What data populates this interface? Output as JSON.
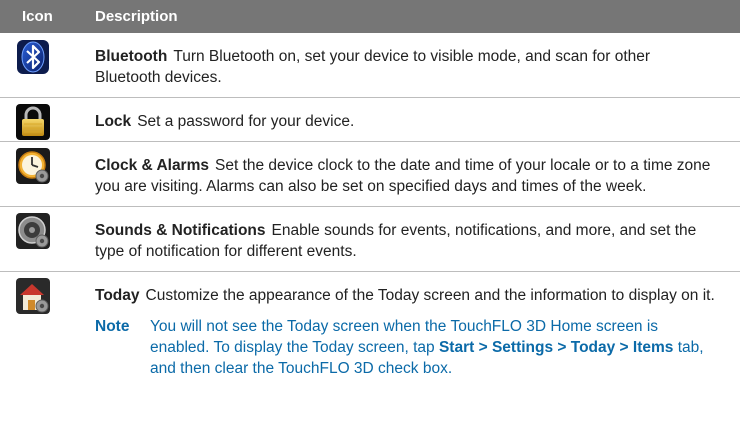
{
  "header": {
    "icon_col": "Icon",
    "description_col": "Description"
  },
  "rows": [
    {
      "icon": "bluetooth-icon",
      "title": "Bluetooth",
      "text": "Turn Bluetooth on, set your device to visible mode, and scan for other Bluetooth devices."
    },
    {
      "icon": "lock-icon",
      "title": "Lock",
      "text": "Set a password for your device."
    },
    {
      "icon": "clock-alarms-icon",
      "title": "Clock & Alarms",
      "text": "Set the device clock to the date and time of your locale or to a time zone you are visiting. Alarms can also be set on specified days and times of the week."
    },
    {
      "icon": "sounds-notifications-icon",
      "title": "Sounds & Notifications",
      "text": "Enable sounds for events, notifications, and more, and set the type of notification for different events."
    },
    {
      "icon": "today-home-icon",
      "title": "Today",
      "text": "Customize the appearance of the Today screen and the information to display on it."
    }
  ],
  "note": {
    "label": "Note",
    "text_before": "You will not see the Today screen when the TouchFLO 3D Home screen is enabled. To display the Today screen, tap ",
    "path": "Start > Settings > Today > Items",
    "text_after": " tab, and then clear the TouchFLO 3D check box."
  },
  "colors": {
    "header_bg": "#767676",
    "note_text": "#0b6aa8",
    "row_divider": "#bdbdbd"
  }
}
